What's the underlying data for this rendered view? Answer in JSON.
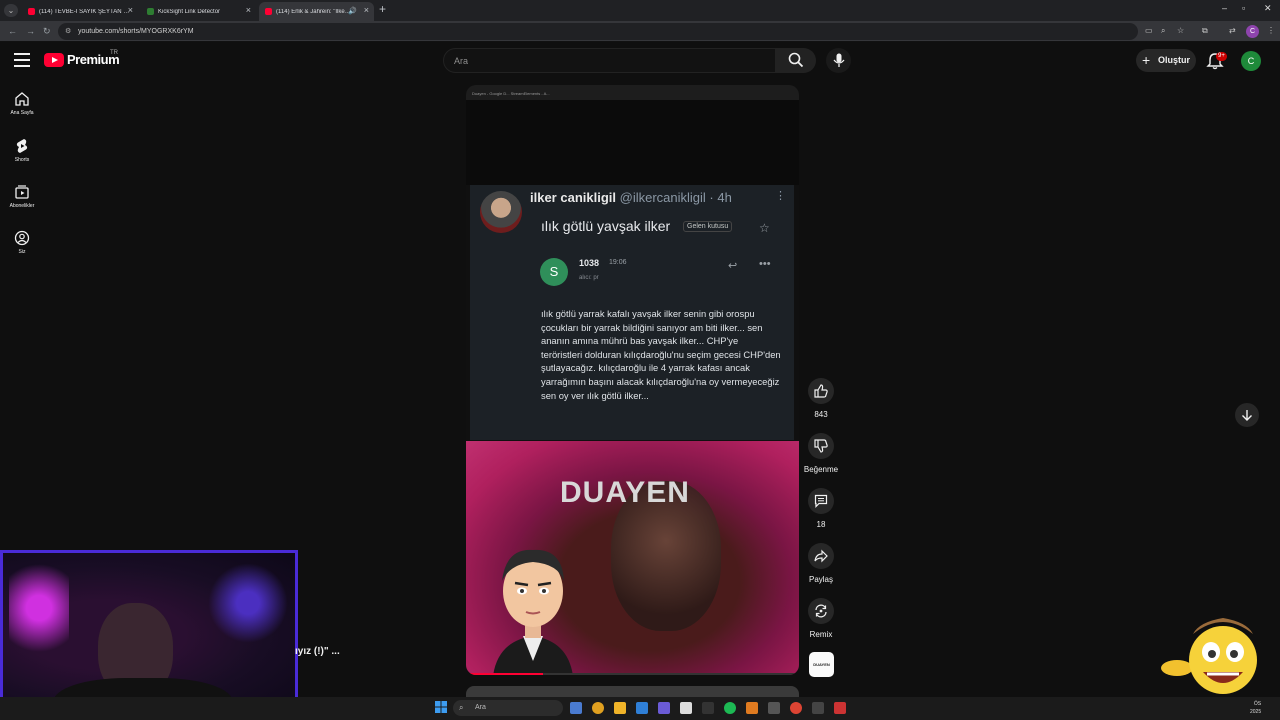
{
  "browser": {
    "tabs": [
      {
        "title": "(114) TEVBE-İ SAYIK ŞEYTAN H...",
        "favicon": "youtube-icon",
        "active": false
      },
      {
        "title": "KickSight Link Detector",
        "favicon": "kicksight-icon",
        "active": false
      },
      {
        "title": "(114) Erlik & Jahrein: \"İlker...",
        "favicon": "youtube-icon",
        "active": true
      }
    ],
    "url": "youtube.com/shorts/MYOGRXK6rYM"
  },
  "masthead": {
    "logo_text": "Premium",
    "country": "TR",
    "search_placeholder": "Ara",
    "create_label": "Oluştur",
    "notification_count": "9+",
    "avatar_letter": "C"
  },
  "guide": [
    {
      "label": "Ana Sayfa",
      "icon": "home-icon"
    },
    {
      "label": "Shorts",
      "icon": "shorts-icon"
    },
    {
      "label": "Abonelikler",
      "icon": "subscriptions-icon"
    },
    {
      "label": "Siz",
      "icon": "you-icon"
    }
  ],
  "short": {
    "top_bar_text": "Duayen - Google D...    StreamElements - A...",
    "tweet": {
      "name": "ilker canikligil",
      "handle": "@ilkercanikligil · 4h"
    },
    "mail": {
      "subject": "ılık götlü yavşak ilker",
      "label": "Gelen kutusu",
      "sender_initial": "S",
      "sender": "1038",
      "time": "19:06",
      "to": "alıcı: pr",
      "body": "ılık götlü yarrak kafalı yavşak ilker senin gibi orospu çocukları bir yarrak bildiğini sanıyor am biti ilker... sen ananın amına mührü bas yavşak ilker... CHP'ye teröristleri dolduran kılıçdaroğlu'nu seçim gecesi CHP'den şutlayacağız. kılıçdaroğlu ile 4 yarrak kafası ancak yarrağımın başını alacak kılıçdaroğlu'na oy vermeyeceğiz sen oy ver ılık götlü ilker..."
    },
    "overlay_text": "DUAYEN",
    "progress": 0.23
  },
  "actions": {
    "like_count": "843",
    "dislike_label": "Beğenme",
    "comment_count": "18",
    "share_label": "Paylaş",
    "remix_label": "Remix",
    "channel_thumb_text": "DUAYEN"
  },
  "caption": "ıyız (!)\" ...",
  "taskbar": {
    "search_placeholder": "Ara",
    "clock": [
      "ÖS",
      "2025"
    ]
  },
  "colors": {
    "youtube_red": "#ff0033",
    "background": "#0f0f0f",
    "webcam_border": "#4a2bd8"
  }
}
